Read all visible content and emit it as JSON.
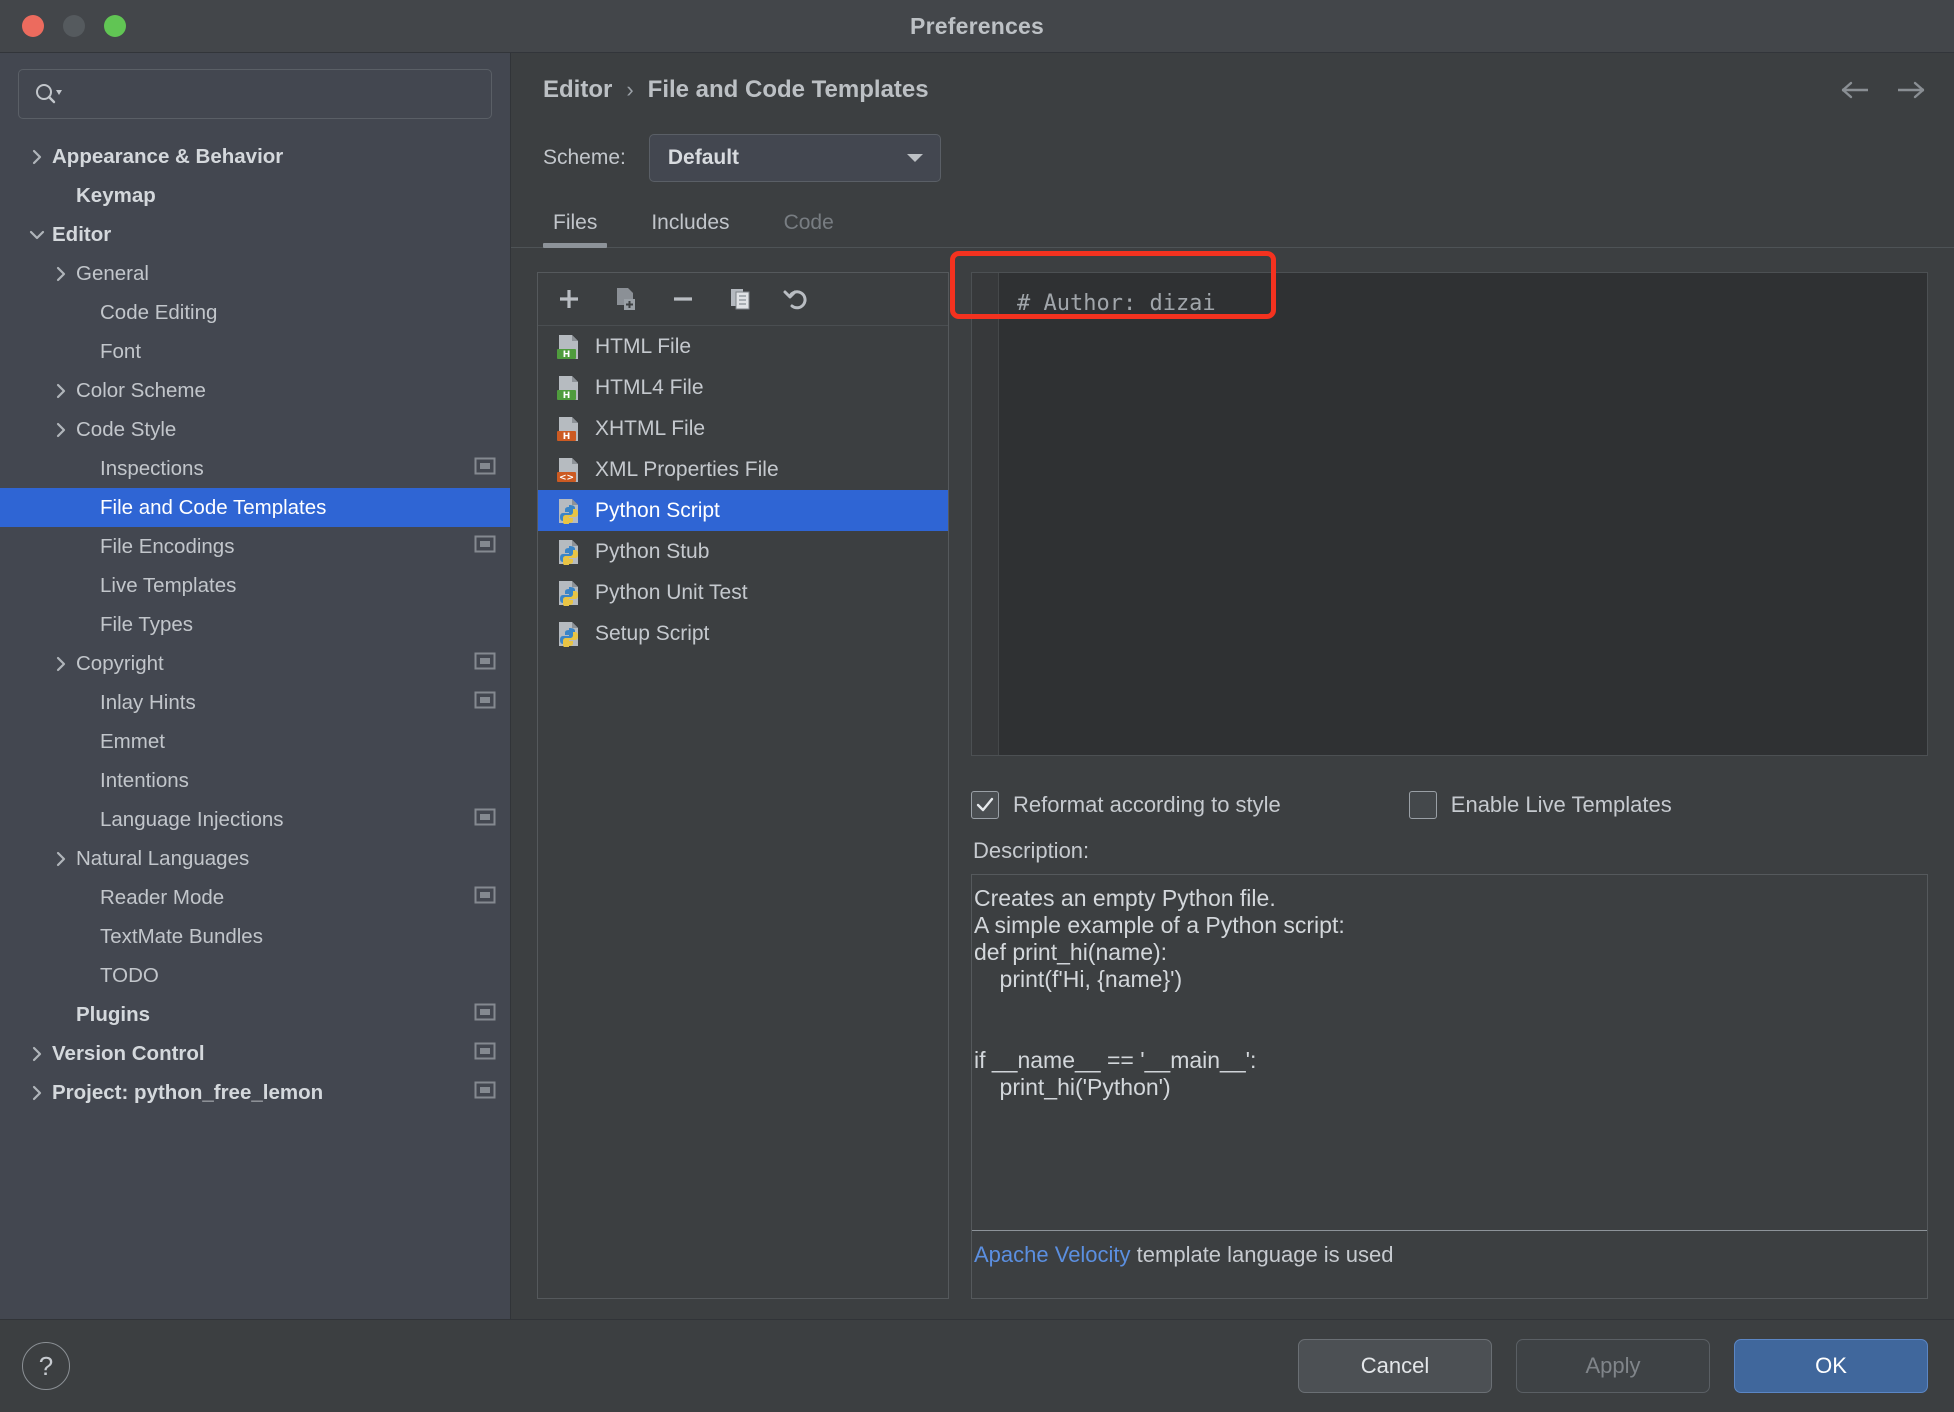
{
  "window": {
    "title": "Preferences",
    "traffic": {
      "close": "close-button",
      "minimize": "minimize-button",
      "zoom": "zoom-button"
    }
  },
  "sidebar": {
    "search": {
      "value": "",
      "placeholder": ""
    },
    "items": [
      {
        "label": "Appearance & Behavior",
        "arrow": "right",
        "indent": 0,
        "bold": true,
        "config": false,
        "selected": false
      },
      {
        "label": "Keymap",
        "arrow": "none",
        "indent": 1,
        "bold": true,
        "config": false,
        "selected": false
      },
      {
        "label": "Editor",
        "arrow": "down",
        "indent": 0,
        "bold": true,
        "config": false,
        "selected": false
      },
      {
        "label": "General",
        "arrow": "right",
        "indent": 1,
        "bold": false,
        "config": false,
        "selected": false
      },
      {
        "label": "Code Editing",
        "arrow": "none",
        "indent": 2,
        "bold": false,
        "config": false,
        "selected": false
      },
      {
        "label": "Font",
        "arrow": "none",
        "indent": 2,
        "bold": false,
        "config": false,
        "selected": false
      },
      {
        "label": "Color Scheme",
        "arrow": "right",
        "indent": 1,
        "bold": false,
        "config": false,
        "selected": false
      },
      {
        "label": "Code Style",
        "arrow": "right",
        "indent": 1,
        "bold": false,
        "config": false,
        "selected": false
      },
      {
        "label": "Inspections",
        "arrow": "none",
        "indent": 2,
        "bold": false,
        "config": true,
        "selected": false
      },
      {
        "label": "File and Code Templates",
        "arrow": "none",
        "indent": 2,
        "bold": false,
        "config": false,
        "selected": true
      },
      {
        "label": "File Encodings",
        "arrow": "none",
        "indent": 2,
        "bold": false,
        "config": true,
        "selected": false
      },
      {
        "label": "Live Templates",
        "arrow": "none",
        "indent": 2,
        "bold": false,
        "config": false,
        "selected": false
      },
      {
        "label": "File Types",
        "arrow": "none",
        "indent": 2,
        "bold": false,
        "config": false,
        "selected": false
      },
      {
        "label": "Copyright",
        "arrow": "right",
        "indent": 1,
        "bold": false,
        "config": true,
        "selected": false
      },
      {
        "label": "Inlay Hints",
        "arrow": "none",
        "indent": 2,
        "bold": false,
        "config": true,
        "selected": false
      },
      {
        "label": "Emmet",
        "arrow": "none",
        "indent": 2,
        "bold": false,
        "config": false,
        "selected": false
      },
      {
        "label": "Intentions",
        "arrow": "none",
        "indent": 2,
        "bold": false,
        "config": false,
        "selected": false
      },
      {
        "label": "Language Injections",
        "arrow": "none",
        "indent": 2,
        "bold": false,
        "config": true,
        "selected": false
      },
      {
        "label": "Natural Languages",
        "arrow": "right",
        "indent": 1,
        "bold": false,
        "config": false,
        "selected": false
      },
      {
        "label": "Reader Mode",
        "arrow": "none",
        "indent": 2,
        "bold": false,
        "config": true,
        "selected": false
      },
      {
        "label": "TextMate Bundles",
        "arrow": "none",
        "indent": 2,
        "bold": false,
        "config": false,
        "selected": false
      },
      {
        "label": "TODO",
        "arrow": "none",
        "indent": 2,
        "bold": false,
        "config": false,
        "selected": false
      },
      {
        "label": "Plugins",
        "arrow": "none",
        "indent": 1,
        "bold": true,
        "config": true,
        "selected": false
      },
      {
        "label": "Version Control",
        "arrow": "right",
        "indent": 0,
        "bold": true,
        "config": true,
        "selected": false
      },
      {
        "label": "Project: python_free_lemon",
        "arrow": "right",
        "indent": 0,
        "bold": true,
        "config": true,
        "selected": false
      }
    ]
  },
  "header": {
    "breadcrumb": {
      "parent": "Editor",
      "separator": "›",
      "current": "File and Code Templates"
    },
    "nav": {
      "back": "back-arrow-icon",
      "forward": "forward-arrow-icon"
    },
    "scheme": {
      "label": "Scheme:",
      "value": "Default"
    }
  },
  "tabs": [
    {
      "label": "Files",
      "state": "active"
    },
    {
      "label": "Includes",
      "state": "normal"
    },
    {
      "label": "Code",
      "state": "disabled"
    }
  ],
  "list_toolbar": [
    {
      "name": "add-icon",
      "glyph": "+"
    },
    {
      "name": "copy-file-icon",
      "glyph": ""
    },
    {
      "name": "remove-icon",
      "glyph": "−"
    },
    {
      "name": "duplicate-icon",
      "glyph": ""
    },
    {
      "name": "reset-icon",
      "glyph": "↩"
    }
  ],
  "file_list": [
    {
      "label": "HTML File",
      "icon": "html-file-icon",
      "badge": "H",
      "badge_color": "#4f9c3d",
      "selected": false
    },
    {
      "label": "HTML4 File",
      "icon": "html4-file-icon",
      "badge": "H",
      "badge_color": "#4f9c3d",
      "selected": false
    },
    {
      "label": "XHTML File",
      "icon": "xhtml-file-icon",
      "badge": "H",
      "badge_color": "#cc5a22",
      "selected": false
    },
    {
      "label": "XML Properties File",
      "icon": "xml-properties-icon",
      "badge": "<>",
      "badge_color": "#cc5a22",
      "selected": false
    },
    {
      "label": "Python Script",
      "icon": "python-file-icon",
      "badge": "py",
      "badge_color": "#3a85c8",
      "selected": true
    },
    {
      "label": "Python Stub",
      "icon": "python-file-icon",
      "badge": "py",
      "badge_color": "#3a85c8",
      "selected": false
    },
    {
      "label": "Python Unit Test",
      "icon": "python-file-icon",
      "badge": "py",
      "badge_color": "#3a85c8",
      "selected": false
    },
    {
      "label": "Setup Script",
      "icon": "python-file-icon",
      "badge": "py",
      "badge_color": "#3a85c8",
      "selected": false
    }
  ],
  "editor": {
    "content": "# Author: dizai",
    "highlight_color": "#f4321f"
  },
  "options": {
    "reformat": {
      "label": "Reformat according to style",
      "checked": true
    },
    "live_templates": {
      "label": "Enable Live Templates",
      "checked": false
    }
  },
  "description": {
    "label": "Description:",
    "body": "Creates an empty Python file.\nA simple example of a Python script:\ndef print_hi(name):\n    print(f'Hi, {name}')\n\n\nif __name__ == '__main__':\n    print_hi('Python')",
    "footer_link": "Apache Velocity",
    "footer_rest": " template language is used"
  },
  "footer": {
    "help": "?",
    "cancel": "Cancel",
    "apply": "Apply",
    "ok": "OK"
  },
  "colors": {
    "accent": "#2f65d4",
    "primary_button": "#40679c",
    "link": "#5b8fe0",
    "highlight_box": "#f4321f"
  }
}
